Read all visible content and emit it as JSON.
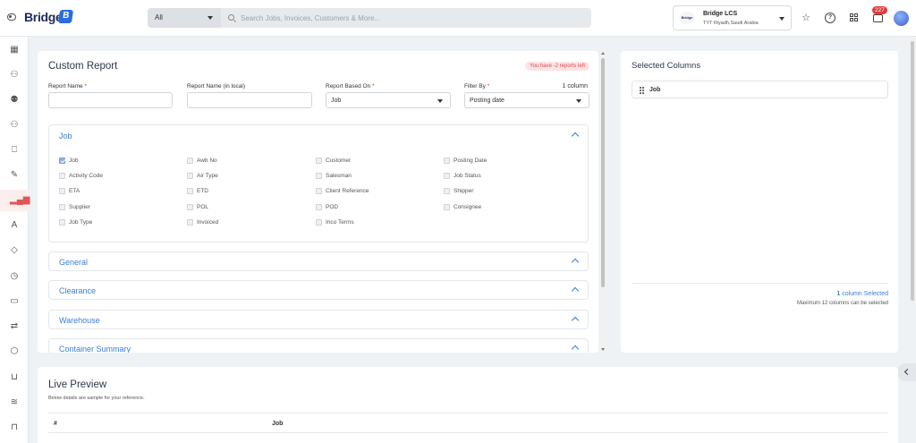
{
  "header": {
    "brand": "Bridge",
    "search": {
      "scope": "All",
      "placeholder": "Search Jobs, Invoices, Customers & More..."
    },
    "company": {
      "logo_text": "Bridge",
      "name": "Bridge LCS",
      "location": "TYT Riyadh,Saudi Arabia"
    },
    "notifications_count": "227"
  },
  "sidebar": {
    "items": [
      {
        "icon": "dashboard-icon"
      },
      {
        "icon": "user-icon"
      },
      {
        "icon": "users-icon"
      },
      {
        "icon": "add-user-icon"
      },
      {
        "icon": "bookmark-icon"
      },
      {
        "icon": "edit-icon"
      },
      {
        "icon": "chart-icon",
        "active": true
      },
      {
        "icon": "font-icon"
      },
      {
        "icon": "tag-icon"
      },
      {
        "icon": "clock-icon"
      },
      {
        "icon": "card-icon"
      },
      {
        "icon": "transfer-icon"
      },
      {
        "icon": "box-icon"
      },
      {
        "icon": "cart-icon"
      },
      {
        "icon": "layers-icon"
      },
      {
        "icon": "inbox-icon"
      }
    ]
  },
  "report": {
    "title": "Custom Report",
    "reports_left": "You have -2 reports left",
    "fields": {
      "report_name": {
        "label": "Report Name",
        "required": "*",
        "value": ""
      },
      "report_name_local": {
        "label": "Report Name (in local)",
        "value": ""
      },
      "based_on": {
        "label": "Report Based On",
        "required": "*",
        "value": "Job"
      },
      "filter_by": {
        "label": "Filter By",
        "required": "*",
        "value": "Posting date"
      }
    },
    "column_count": "1 column",
    "sections": [
      {
        "title": "Job",
        "expanded": true,
        "columns": [
          [
            "Job",
            "Awb No",
            "Customer",
            "Posting Date"
          ],
          [
            "Activity Code",
            "Air Type",
            "Salesman",
            "Job Status"
          ],
          [
            "ETA",
            "ETD",
            "Client Reference",
            "Shipper"
          ],
          [
            "Supplier",
            "POL",
            "POD",
            "Consignee"
          ],
          [
            "Job Type",
            "Invoiced",
            "Inco Terms",
            ""
          ]
        ],
        "checked": [
          "Job"
        ]
      },
      {
        "title": "General"
      },
      {
        "title": "Clearance"
      },
      {
        "title": "Warehouse"
      },
      {
        "title": "Container Summary"
      }
    ]
  },
  "selected": {
    "title": "Selected Columns",
    "items": [
      "Job"
    ],
    "count_number": "1",
    "count_text": " column Selected",
    "max_text": "Maximum 12 columns can be selected"
  },
  "preview": {
    "title": "Live Preview",
    "subtitle": "Below details are sample for your reference.",
    "columns": [
      "#",
      "Job"
    ]
  },
  "colors": {
    "accent": "#3b7dd8",
    "danger": "#e04545",
    "active_nav": "#e45454"
  }
}
